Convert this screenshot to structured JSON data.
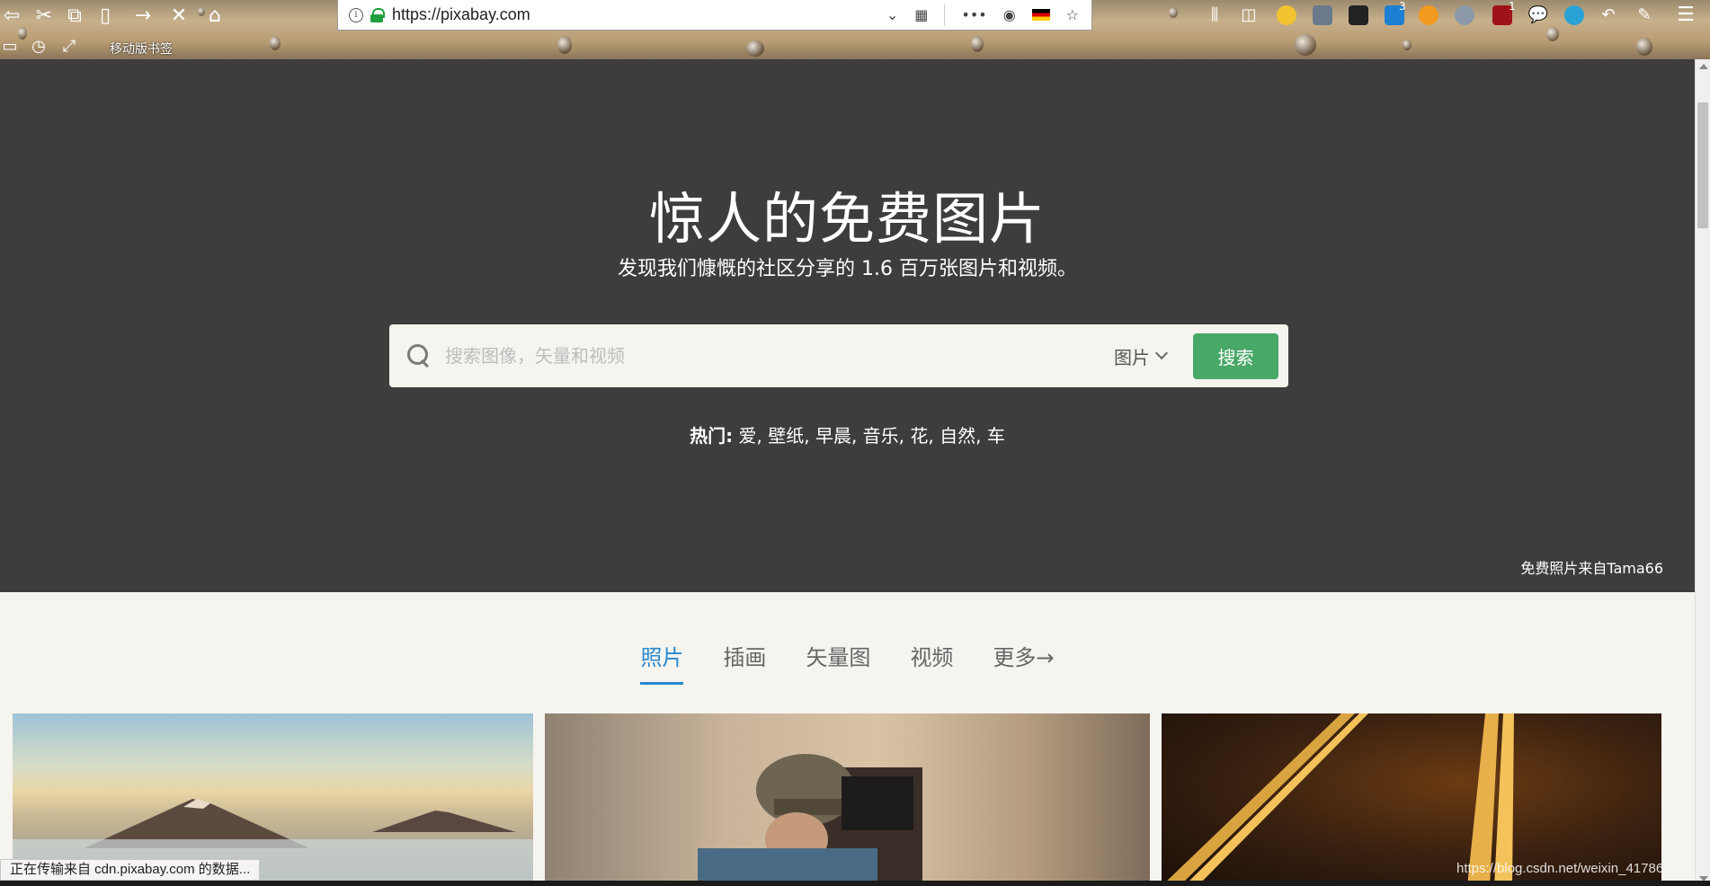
{
  "browser": {
    "url": "https://pixabay.com",
    "bookmark_label": "移动版书签",
    "toolbar_icons": [
      "back-icon",
      "cut-icon",
      "copy-icon",
      "paste-icon",
      "forward-icon",
      "stop-icon",
      "home-icon"
    ],
    "ext_badges": {
      "s_badge": "3",
      "ublock_badge": "1"
    }
  },
  "hero": {
    "title": "惊人的免费图片",
    "subtitle": "发现我们慷慨的社区分享的 1.6 百万张图片和视频。",
    "search": {
      "placeholder": "搜索图像，矢量和视频",
      "type_selected": "图片",
      "button_label": "搜索"
    },
    "popular": {
      "label": "热门:",
      "tags": [
        "爱",
        "壁纸",
        "早晨",
        "音乐",
        "花",
        "自然",
        "车"
      ]
    },
    "credit": "免费照片来自Tama66"
  },
  "tabs": [
    {
      "label": "照片",
      "active": true
    },
    {
      "label": "插画",
      "active": false
    },
    {
      "label": "矢量图",
      "active": false
    },
    {
      "label": "视频",
      "active": false
    },
    {
      "label": "更多→",
      "active": false
    }
  ],
  "status": {
    "text": "正在传输来自 cdn.pixabay.com 的数据...",
    "watermark": "https://blog.csdn.net/weixin_41786"
  },
  "colors": {
    "hero_bg": "#3d3d3d",
    "accent_blue": "#2a88cf",
    "search_button": "#48a868",
    "page_bg": "#f6f4ef"
  }
}
